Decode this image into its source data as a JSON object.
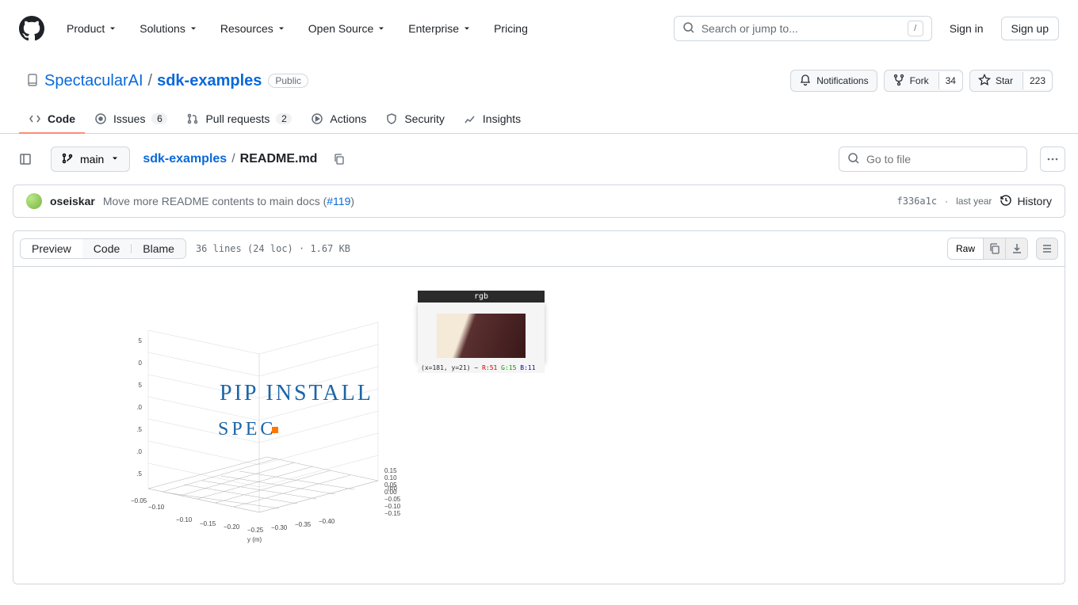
{
  "header": {
    "nav": [
      "Product",
      "Solutions",
      "Resources",
      "Open Source",
      "Enterprise",
      "Pricing"
    ],
    "search_placeholder": "Search or jump to...",
    "slash": "/",
    "sign_in": "Sign in",
    "sign_up": "Sign up"
  },
  "repo": {
    "owner": "SpectacularAI",
    "name": "sdk-examples",
    "visibility": "Public",
    "actions": {
      "notifications": "Notifications",
      "fork": "Fork",
      "fork_count": "34",
      "star": "Star",
      "star_count": "223"
    }
  },
  "tabs": {
    "code": "Code",
    "issues": "Issues",
    "issues_count": "6",
    "pulls": "Pull requests",
    "pulls_count": "2",
    "actions": "Actions",
    "security": "Security",
    "insights": "Insights"
  },
  "file": {
    "branch": "main",
    "crumb_root": "sdk-examples",
    "crumb_current": "README.md",
    "gotofile_placeholder": "Go to file"
  },
  "commit": {
    "author": "oseiskar",
    "message": "Move more README contents to main docs (",
    "pr": "#119",
    "message_end": ")",
    "hash": "f336a1c",
    "sep": "·",
    "when": "last year",
    "history": "History"
  },
  "viewer": {
    "preview": "Preview",
    "code": "Code",
    "blame": "Blame",
    "info": "36 lines (24 loc) · 1.67 KB",
    "raw": "Raw"
  },
  "readme_graphic": {
    "text1": "PIP INSTALL",
    "text2": "SPEC",
    "rgb_title": "rgb",
    "rgb_status_prefix": "(x=181, y=21) ~ ",
    "rgb_r": "R:51",
    "rgb_g": "G:15",
    "rgb_b": "B:11",
    "z_ticks": [
      "5",
      "0",
      "5",
      ".0",
      ".5",
      ".0",
      ".5"
    ],
    "x_ticks": [
      "−0.10",
      "−0.15",
      "−0.20",
      "−0.25",
      "−0.30",
      "−0.35",
      "−0.40"
    ],
    "y_ticks_left": [
      "−0.10",
      "−0.05"
    ],
    "y_ticks_right": [
      "0.15",
      "0.10",
      "0.05",
      "0.00",
      "−0.05",
      "−0.10",
      "−0.15"
    ],
    "axis_unit": "(m)"
  }
}
